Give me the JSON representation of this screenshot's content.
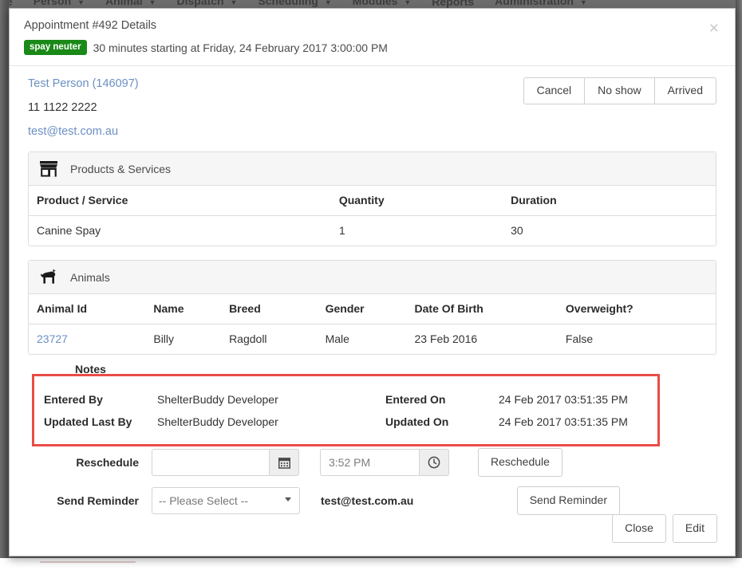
{
  "app_nav": {
    "items": [
      {
        "label": "le",
        "caret": false
      },
      {
        "label": "Person",
        "caret": true
      },
      {
        "label": "Animal",
        "caret": true
      },
      {
        "label": "Dispatch",
        "caret": true
      },
      {
        "label": "Scheduling",
        "caret": true
      },
      {
        "label": "Modules",
        "caret": true
      },
      {
        "label": "Reports",
        "caret": false
      },
      {
        "label": "Administration",
        "caret": true
      }
    ],
    "caret_glyph": "▼"
  },
  "modal": {
    "title": "Appointment #492 Details",
    "badge": "spay neuter",
    "badge_color": "#1a8917",
    "subtitle": "30 minutes starting at Friday, 24 February 2017 3:00:00 PM",
    "close_label": "×"
  },
  "person": {
    "name_link": "Test Person (146097)",
    "phone": "11 1122 2222",
    "email": "test@test.com.au"
  },
  "status_buttons": [
    {
      "label": "Cancel"
    },
    {
      "label": "No show"
    },
    {
      "label": "Arrived"
    }
  ],
  "products_panel": {
    "icon": "store-icon",
    "title": "Products & Services",
    "columns": [
      "Product / Service",
      "Quantity",
      "Duration"
    ],
    "rows": [
      {
        "product": "Canine Spay",
        "quantity": "1",
        "duration": "30"
      }
    ]
  },
  "animals_panel": {
    "icon": "dog-icon",
    "title": "Animals",
    "columns": [
      "Animal Id",
      "Name",
      "Breed",
      "Gender",
      "Date Of Birth",
      "Overweight?"
    ],
    "rows": [
      {
        "animal_id": "23727",
        "name": "Billy",
        "breed": "Ragdoll",
        "gender": "Male",
        "dob": "23 Feb 2016",
        "overweight": "False"
      }
    ]
  },
  "notes": {
    "label": "Notes",
    "highlight_color": "#ea4c46",
    "entered_by_label": "Entered By",
    "entered_by_value": "ShelterBuddy Developer",
    "entered_on_label": "Entered On",
    "entered_on_value": "24 Feb 2017 03:51:35 PM",
    "updated_by_label": "Updated Last By",
    "updated_by_value": "ShelterBuddy Developer",
    "updated_on_label": "Updated On",
    "updated_on_value": "24 Feb 2017 03:51:35 PM"
  },
  "reschedule": {
    "label": "Reschedule",
    "date_value": "",
    "date_placeholder": "",
    "calendar_icon": "calendar-icon",
    "time_value": "3:52 PM",
    "clock_icon": "clock-icon",
    "button_label": "Reschedule"
  },
  "send_reminder": {
    "label": "Send Reminder",
    "select_value": "-- Please Select --",
    "select_options": [
      "-- Please Select --"
    ],
    "email": "test@test.com.au",
    "button_label": "Send Reminder"
  },
  "footer": {
    "close_label": "Close",
    "edit_label": "Edit"
  }
}
